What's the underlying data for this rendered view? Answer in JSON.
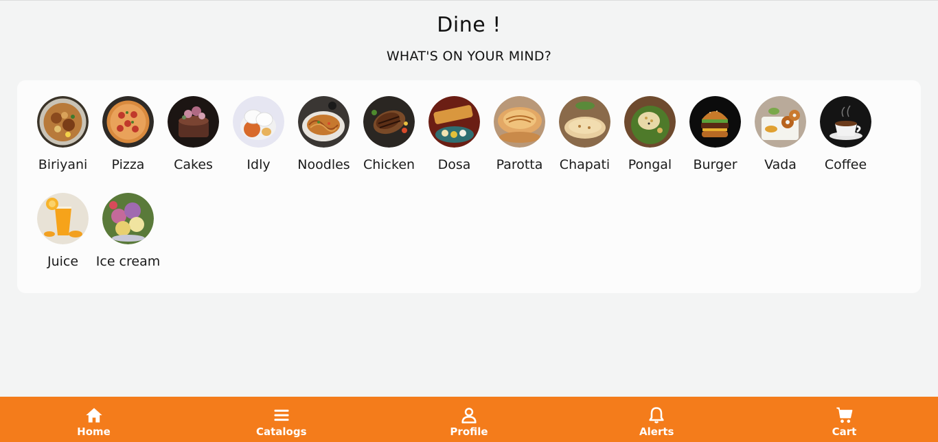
{
  "header": {
    "title": "Dine !",
    "subtitle": "WHAT'S ON YOUR MIND?"
  },
  "categories": [
    {
      "label": "Biriyani",
      "icon": "biriyani-image"
    },
    {
      "label": "Pizza",
      "icon": "pizza-image"
    },
    {
      "label": "Cakes",
      "icon": "cakes-image"
    },
    {
      "label": "Idly",
      "icon": "idly-image"
    },
    {
      "label": "Noodles",
      "icon": "noodles-image"
    },
    {
      "label": "Chicken",
      "icon": "chicken-image"
    },
    {
      "label": "Dosa",
      "icon": "dosa-image"
    },
    {
      "label": "Parotta",
      "icon": "parotta-image"
    },
    {
      "label": "Chapati",
      "icon": "chapati-image"
    },
    {
      "label": "Pongal",
      "icon": "pongal-image"
    },
    {
      "label": "Burger",
      "icon": "burger-image"
    },
    {
      "label": "Vada",
      "icon": "vada-image"
    },
    {
      "label": "Coffee",
      "icon": "coffee-image"
    },
    {
      "label": "Juice",
      "icon": "juice-image"
    },
    {
      "label": "Ice cream",
      "icon": "ice-cream-image"
    }
  ],
  "nav": {
    "items": [
      {
        "label": "Home",
        "icon": "home-icon"
      },
      {
        "label": "Catalogs",
        "icon": "menu-icon"
      },
      {
        "label": "Profile",
        "icon": "user-icon"
      },
      {
        "label": "Alerts",
        "icon": "bell-icon"
      },
      {
        "label": "Cart",
        "icon": "cart-icon"
      }
    ]
  },
  "colors": {
    "accent": "#f47c1b",
    "background": "#f3f4f4",
    "panel": "#fcfcfc"
  }
}
